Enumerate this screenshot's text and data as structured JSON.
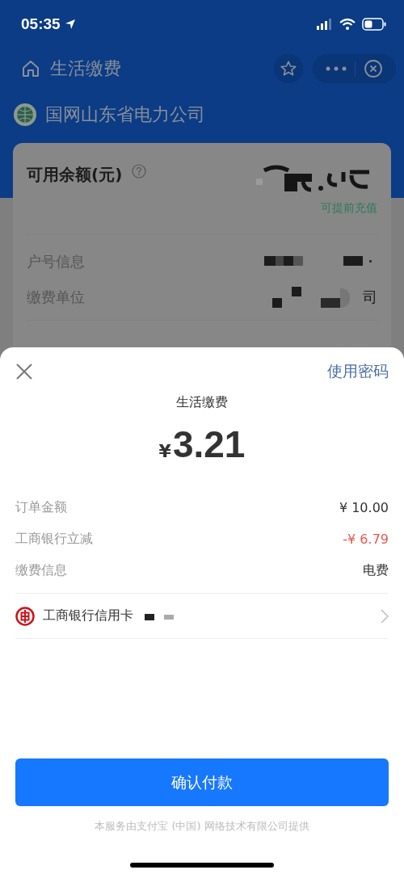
{
  "status_bar": {
    "time": "05:35"
  },
  "nav_bar": {
    "title": "生活缴费"
  },
  "company": {
    "name": "国网山东省电力公司"
  },
  "account_card": {
    "balance_label": "可用余额(元)",
    "recharge_link": "可提前充值",
    "rows": [
      {
        "label": "户号信息"
      },
      {
        "label": "缴费单位",
        "value": "司"
      }
    ]
  },
  "payment_sheet": {
    "password_link": "使用密码",
    "title": "生活缴费",
    "currency": "¥",
    "amount": "3.21",
    "details": [
      {
        "label": "订单金额",
        "value": "¥ 10.00",
        "kind": "normal"
      },
      {
        "label": "工商银行立减",
        "value": "-¥ 6.79",
        "kind": "discount"
      },
      {
        "label": "缴费信息",
        "value": "电费",
        "kind": "normal"
      }
    ],
    "payment_method": "工商银行信用卡",
    "confirm_button": "确认付款",
    "footer": "本服务由支付宝 (中国) 网络技术有限公司提供"
  }
}
